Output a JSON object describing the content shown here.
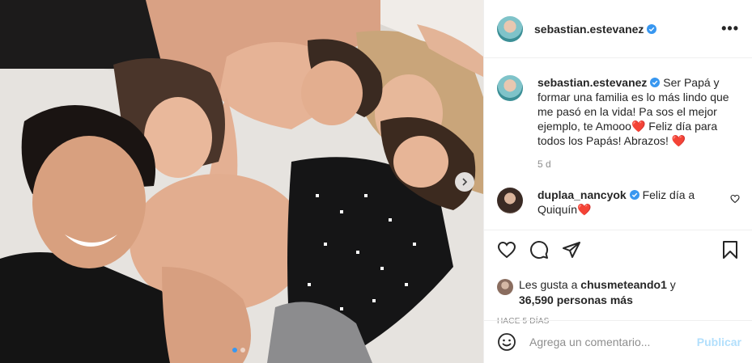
{
  "post": {
    "author": "sebastian.estevanez",
    "caption": "Ser Papá y formar una familia es lo más lindo que me pasó en la vida! Pa sos el mejor ejemplo, te Amooo❤️ Feliz día para todos los Papás! Abrazos! ❤️",
    "caption_age": "5 d"
  },
  "comments": [
    {
      "author": "duplaa_nancyok",
      "text": "Feliz día a Quiquín❤️"
    }
  ],
  "likes": {
    "prefix": "Les gusta a",
    "user": "chusmeteando1",
    "connector": "y",
    "count_text": "36,590 personas más"
  },
  "posted": "HACE 5 DÍAS",
  "comment_box": {
    "placeholder": "Agrega un comentario...",
    "publish_label": "Publicar"
  },
  "carousel": {
    "total": 2,
    "current": 1
  },
  "colors": {
    "accent": "#3897f0",
    "publish_disabled": "#b2dffc",
    "verified": "#3897f0",
    "heart": "#ed4956"
  },
  "icons": [
    "verified-badge-icon",
    "more-options-icon",
    "heart-icon",
    "comment-icon",
    "share-icon",
    "bookmark-icon",
    "emoji-icon",
    "chevron-right-icon"
  ]
}
